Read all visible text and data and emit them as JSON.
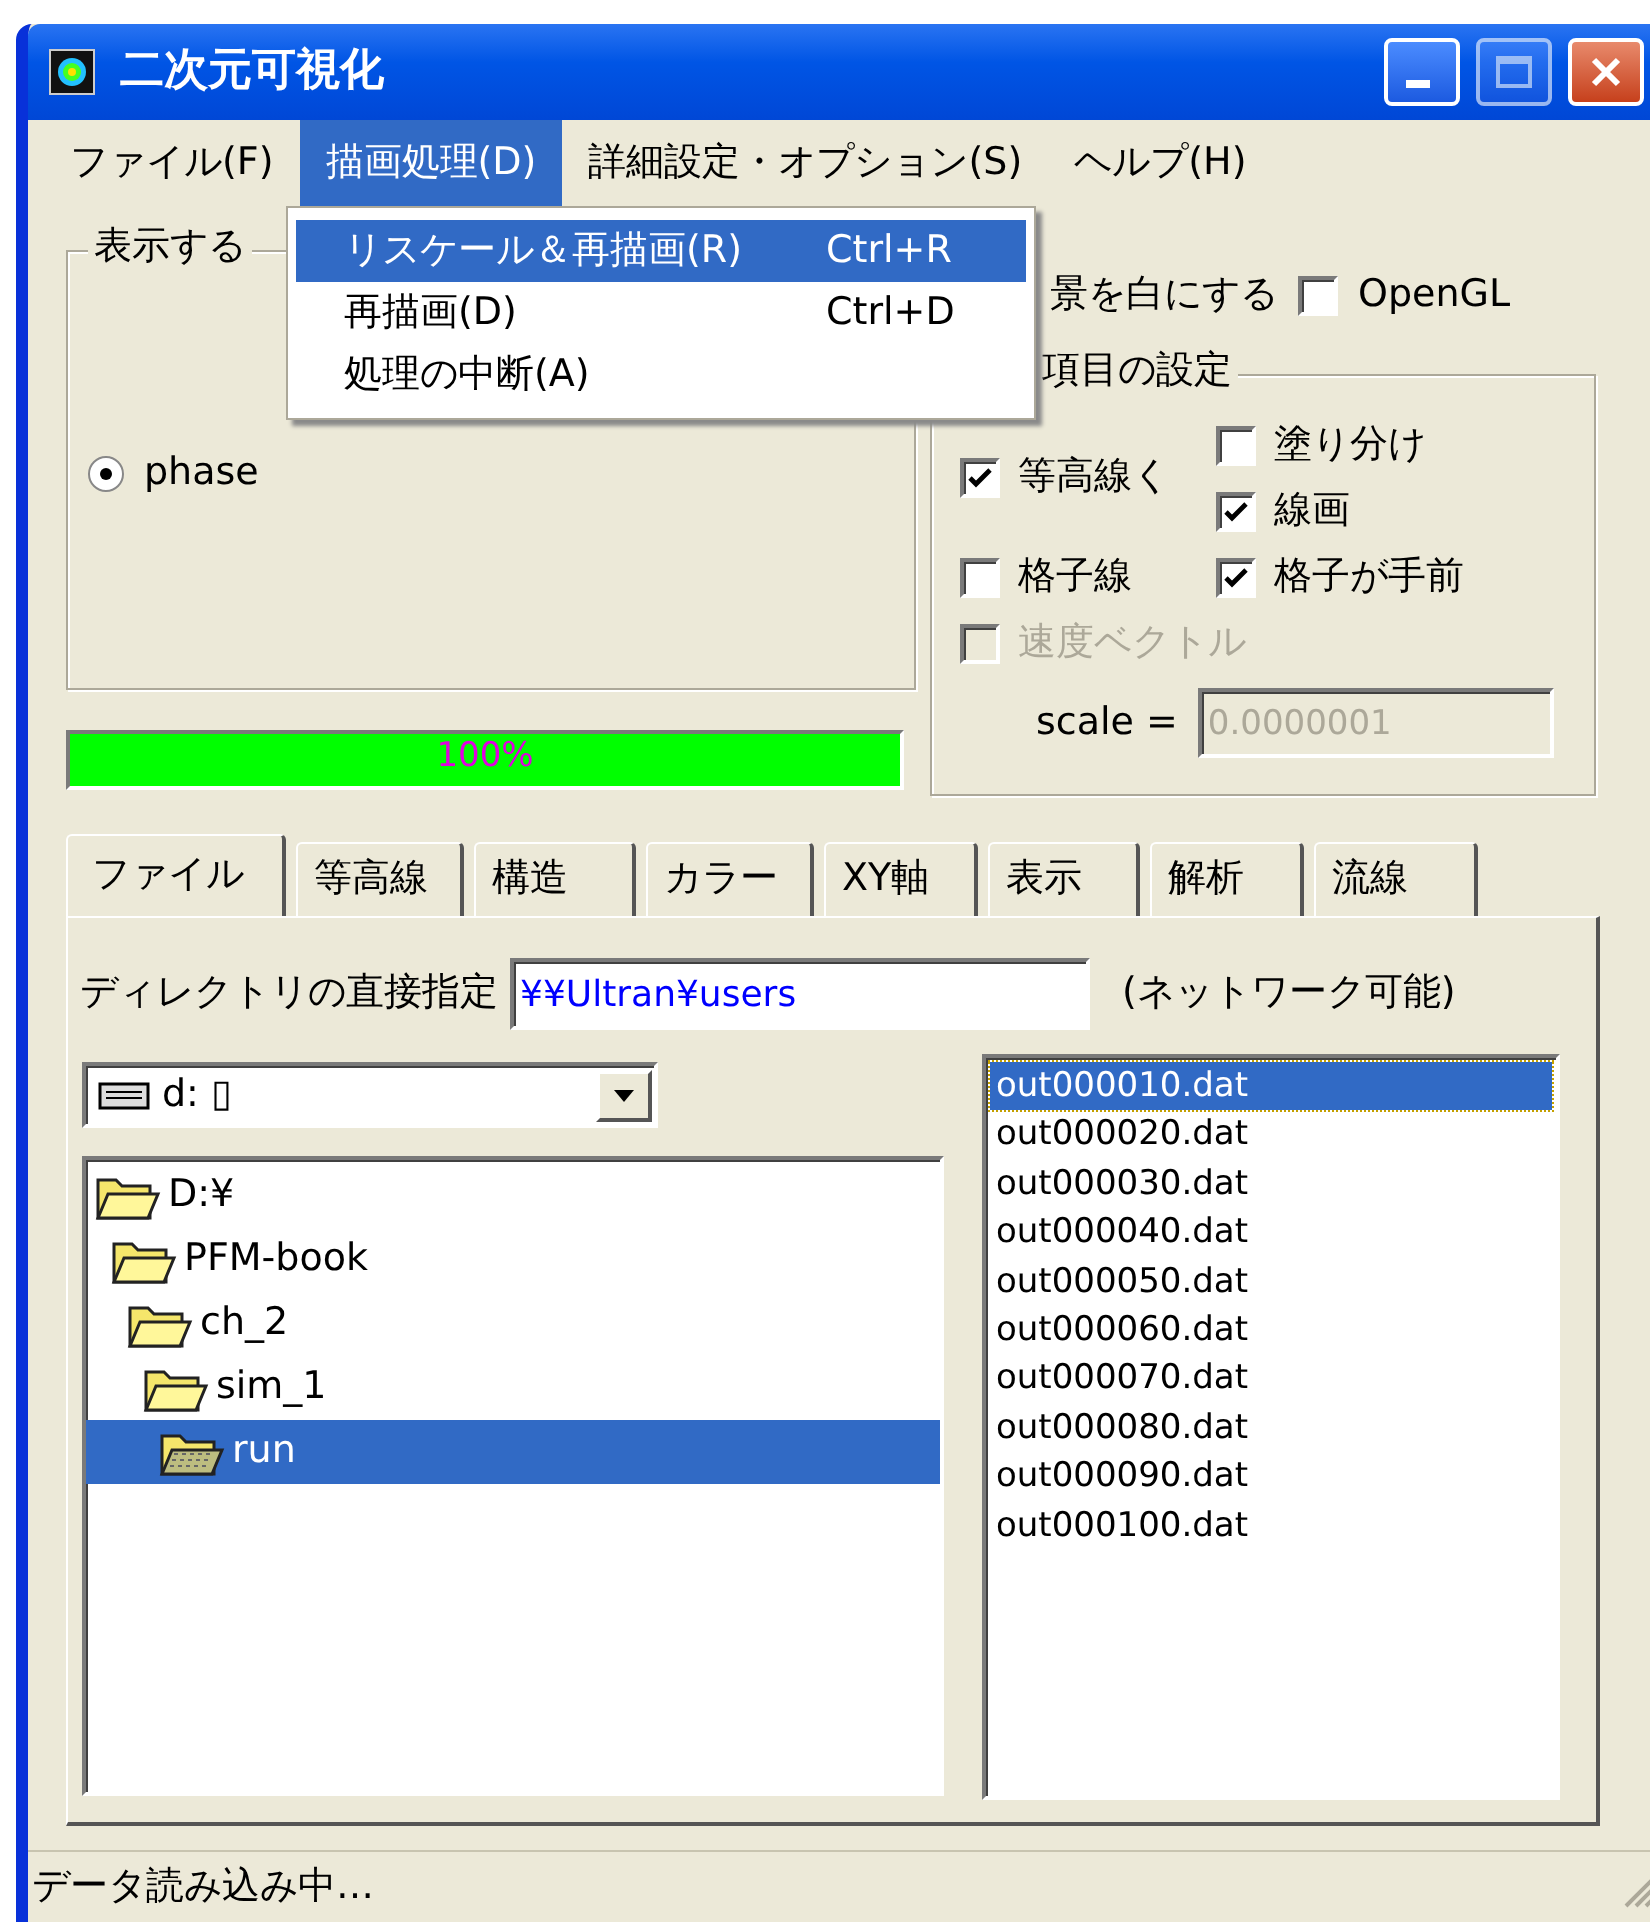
{
  "window": {
    "title": "二次元可視化"
  },
  "menu_bar": [
    {
      "label": "ファイル(F)",
      "selected": false
    },
    {
      "label": "描画処理(D)",
      "selected": true
    },
    {
      "label": "詳細設定・オプション(S)",
      "selected": false
    },
    {
      "label": "ヘルプ(H)",
      "selected": false
    }
  ],
  "open_menu": {
    "items": [
      {
        "label": "リスケール＆再描画(R)",
        "shortcut": "Ctrl+R",
        "selected": true
      },
      {
        "label": "再描画(D)",
        "shortcut": "Ctrl+D",
        "selected": false
      },
      {
        "label": "処理の中断(A)",
        "selected": false
      }
    ]
  },
  "display_group": {
    "title": "表示する",
    "options": [
      {
        "label": "phase",
        "selected": true
      }
    ]
  },
  "progress": {
    "level": 1,
    "text": "100%"
  },
  "background_label": "景を白にする",
  "opengl": {
    "label": "OpenGL",
    "checked": false
  },
  "display_items": {
    "title": "項目の設定",
    "checkboxes": [
      {
        "label": "塗り分け",
        "checked": false,
        "disabled": false
      },
      {
        "label": "等高線く",
        "checked": true,
        "disabled": false
      },
      {
        "label": "線画",
        "checked": true,
        "disabled": false
      },
      {
        "label": "格子線",
        "checked": false,
        "disabled": false
      },
      {
        "label": "格子が手前",
        "checked": true,
        "disabled": false
      },
      {
        "label": "速度ベクトル",
        "checked": false,
        "disabled": true
      }
    ],
    "scale": {
      "label": "scale =",
      "value": "0.0000001",
      "disabled": true
    }
  },
  "tabs": [
    {
      "label": "ファイル",
      "selected": true
    },
    {
      "label": "等高線",
      "selected": false
    },
    {
      "label": "構造",
      "selected": false
    },
    {
      "label": "カラー",
      "selected": false
    },
    {
      "label": "XY軸",
      "selected": false
    },
    {
      "label": "表示",
      "selected": false
    },
    {
      "label": "解析",
      "selected": false
    },
    {
      "label": "流線",
      "selected": false
    }
  ],
  "directory": {
    "label": "ディレクトリの直接指定",
    "value": "¥¥Ultran¥users",
    "note": "(ネットワーク可能)"
  },
  "drive": {
    "value": "d: ▯"
  },
  "tree": [
    {
      "label": "D:¥",
      "selected": false,
      "children": [
        {
          "label": "PFM-book",
          "selected": false,
          "children": [
            {
              "label": "ch_2",
              "selected": false,
              "children": [
                {
                  "label": "sim_1",
                  "selected": false,
                  "children": [
                    {
                      "label": "run",
                      "selected": true
                    }
                  ]
                }
              ]
            }
          ]
        }
      ]
    }
  ],
  "files": [
    {
      "name": "out000010.dat",
      "selected": true
    },
    {
      "name": "out000020.dat",
      "selected": false
    },
    {
      "name": "out000030.dat",
      "selected": false
    },
    {
      "name": "out000040.dat",
      "selected": false
    },
    {
      "name": "out000050.dat",
      "selected": false
    },
    {
      "name": "out000060.dat",
      "selected": false
    },
    {
      "name": "out000070.dat",
      "selected": false
    },
    {
      "name": "out000080.dat",
      "selected": false
    },
    {
      "name": "out000090.dat",
      "selected": false
    },
    {
      "name": "out000100.dat",
      "selected": false
    }
  ],
  "status_bar": "データ読み込み中…"
}
